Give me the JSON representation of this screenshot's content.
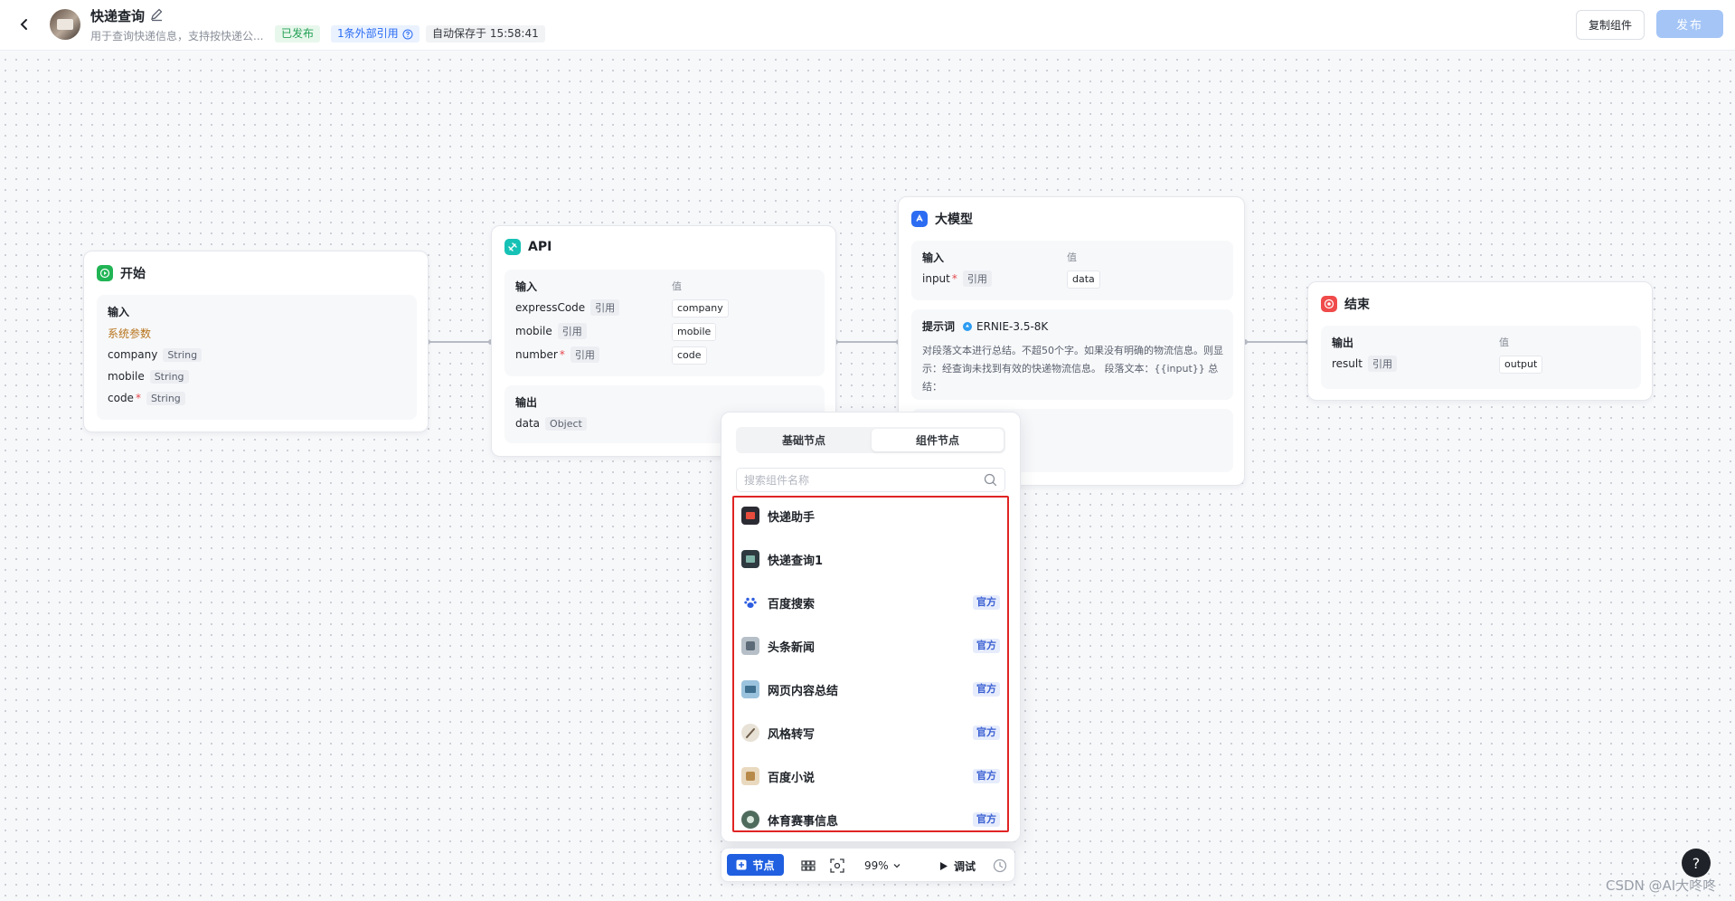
{
  "header": {
    "title": "快递查询",
    "description": "用于查询快递信息，支持按快递公...",
    "status_badge": "已发布",
    "ref_badge": "1条外部引用",
    "autosave": "自动保存于 15:58:41",
    "copy_label": "复制组件",
    "publish_label": "发布"
  },
  "nodes": {
    "start": {
      "title": "开始",
      "input_title": "输入",
      "sys_params": "系统参数",
      "fields": [
        {
          "name": "company",
          "type": "String"
        },
        {
          "name": "mobile",
          "type": "String"
        },
        {
          "name": "code",
          "req": "*",
          "type": "String"
        }
      ]
    },
    "api": {
      "title": "API",
      "input_title": "输入",
      "value_head": "值",
      "fields": [
        {
          "name": "expressCode",
          "tag": "引用",
          "value": "company"
        },
        {
          "name": "mobile",
          "tag": "引用",
          "value": "mobile"
        },
        {
          "name": "number",
          "req": "*",
          "tag": "引用",
          "value": "code"
        }
      ],
      "output_title": "输出",
      "output": {
        "name": "data",
        "type": "Object"
      }
    },
    "llm": {
      "title": "大模型",
      "input_title": "输入",
      "value_head": "值",
      "field": {
        "name": "input",
        "req": "*",
        "tag": "引用",
        "value": "data"
      },
      "prompt_title": "提示词",
      "model": "ERNIE-3.5-8K",
      "prompt_text": "对段落文本进行总结。不超50个字。如果没有明确的物流信息。则显示：经查询未找到有效的快递物流信息。 段落文本：{{input}} 总结："
    },
    "end": {
      "title": "结束",
      "output_title": "输出",
      "value_head": "值",
      "field": {
        "name": "result",
        "tag": "引用",
        "value": "output"
      }
    }
  },
  "popup": {
    "tabs": [
      "基础节点",
      "组件节点"
    ],
    "active_tab": "组件节点",
    "search_placeholder": "搜索组件名称",
    "items": [
      {
        "label": "快递助手",
        "official": ""
      },
      {
        "label": "快递查询1",
        "official": ""
      },
      {
        "label": "百度搜索",
        "official": "官方"
      },
      {
        "label": "头条新闻",
        "official": "官方"
      },
      {
        "label": "网页内容总结",
        "official": "官方"
      },
      {
        "label": "风格转写",
        "official": "官方"
      },
      {
        "label": "百度小说",
        "official": "官方"
      },
      {
        "label": "体育赛事信息",
        "official": "官方"
      }
    ]
  },
  "toolbar": {
    "add_node_label": "节点",
    "zoom": "99%",
    "debug_label": "调试"
  },
  "help_label": "?",
  "watermark": "CSDN @AI大咚咚",
  "colors": {
    "primary": "#1f5fe0",
    "start_icon": "#21b455",
    "api_icon": "#16c2b5",
    "llm_icon": "#2c6cf2",
    "end_icon": "#f04b4b",
    "highlight_border": "#e02424"
  }
}
